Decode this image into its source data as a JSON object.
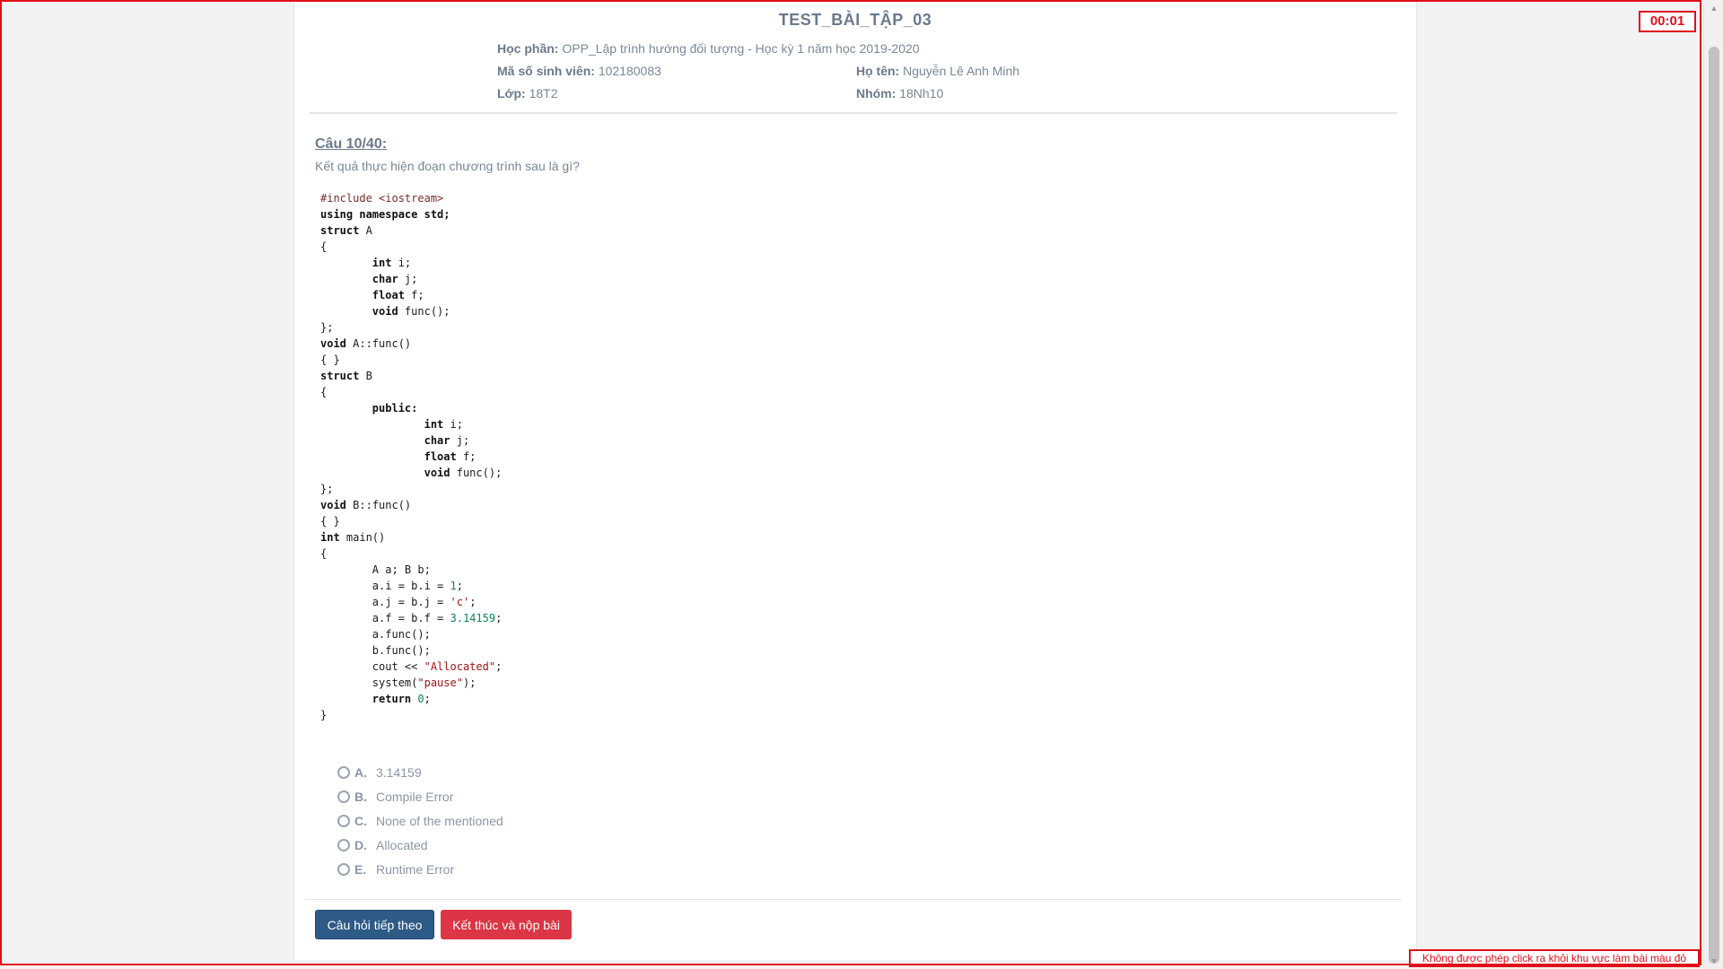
{
  "exam": {
    "title": "TEST_BÀI_TẬP_03",
    "course_label": "Học phần:",
    "course_value": "OPP_Lập trình hướng đối tượng - Học kỳ 1 năm học 2019-2020",
    "student_id_label": "Mã số sinh viên:",
    "student_id_value": "102180083",
    "name_label": "Họ tên:",
    "name_value": "Nguyễn Lê Anh Minh",
    "class_label": "Lớp:",
    "class_value": "18T2",
    "group_label": "Nhóm:",
    "group_value": "18Nh10"
  },
  "question": {
    "label": "Câu 10/40:",
    "text": "Kết quả thực hiện đoạn chương trình sau là gì?"
  },
  "options": [
    {
      "letter": "A.",
      "text": "3.14159"
    },
    {
      "letter": "B.",
      "text": "Compile Error"
    },
    {
      "letter": "C.",
      "text": "None of the mentioned"
    },
    {
      "letter": "D.",
      "text": "Allocated"
    },
    {
      "letter": "E.",
      "text": "Runtime Error"
    }
  ],
  "buttons": {
    "next": "Câu hỏi tiếp theo",
    "submit": "Kết thúc và nộp bài"
  },
  "timer": "00:01",
  "warning": "Không được phép click ra khỏi khu vực làm bài màu đỏ",
  "colors": {
    "frame": "#e0101a",
    "next_button": "#2e5a87",
    "submit_button": "#dc3545"
  }
}
